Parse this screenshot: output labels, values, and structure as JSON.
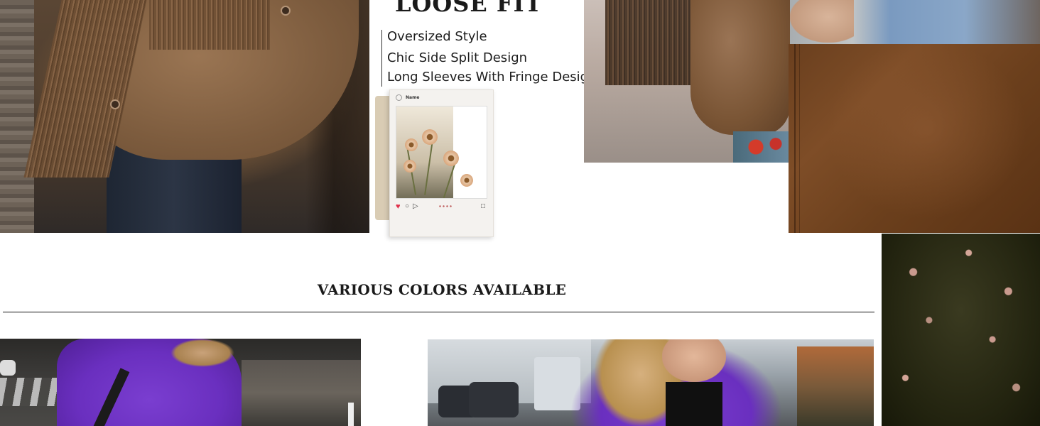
{
  "product": {
    "fit_heading": "LOOSE FIT",
    "features": [
      "Oversized Style",
      "Chic Side Split Design",
      "Long Sleeves With Fringe Design"
    ]
  },
  "social_post": {
    "username": "Name",
    "icons": [
      "heart-icon",
      "comment-icon",
      "share-icon",
      "bookmark-icon"
    ]
  },
  "colors_section": {
    "title": "VARIOUS COLORS AVAILABLE"
  },
  "images": {
    "top_left": "brown suede fringe jacket worn with dark jeans",
    "top_right": "fringe jacket with floral pants",
    "denim_detail": "hand in denim pocket",
    "fabric_closeup": "brown suede texture",
    "foliage": "dark leaves with pink blossoms",
    "bottom_left": "purple suede jacket street view",
    "bottom_right": "purple suede jacket with braided hair street view"
  },
  "colors": {
    "suede_brown": "#7d5c3e",
    "purple": "#6a2fbf",
    "text": "#1a1a1a",
    "heart": "#e0314b"
  }
}
